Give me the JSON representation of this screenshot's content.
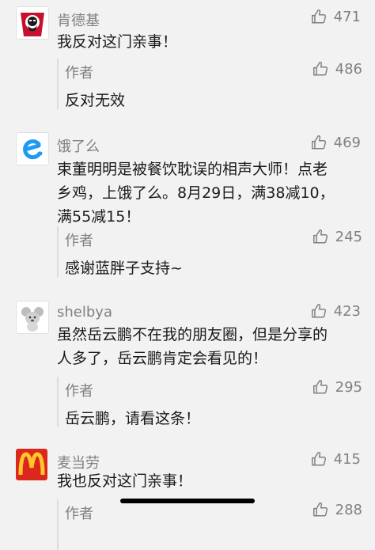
{
  "comments": [
    {
      "author": "肯德基",
      "avatar": "kfc-logo",
      "likes": "471",
      "text": [
        "我反对这门亲事！"
      ],
      "reply": {
        "author": "作者",
        "likes": "486",
        "text": "反对无效"
      }
    },
    {
      "author": "饿了么",
      "avatar": "eleme-logo",
      "likes": "469",
      "text": [
        "束董明明是被餐饮耽误的相声大师！点老",
        "乡鸡，上饿了么。8月29日，满38减10，",
        "满55减15！"
      ],
      "reply": {
        "author": "作者",
        "likes": "245",
        "text": "感谢蓝胖子支持~"
      }
    },
    {
      "author": "shelbya",
      "avatar": "koala-avatar",
      "likes": "423",
      "text": [
        "虽然岳云鹏不在我的朋友圈，但是分享的",
        "人多了，岳云鹏肯定会看见的！"
      ],
      "reply": {
        "author": "作者",
        "likes": "295",
        "text": "岳云鹏，请看这条！"
      }
    },
    {
      "author": "麦当劳",
      "avatar": "mcdonalds-logo",
      "likes": "415",
      "text": [
        "我也反对这门亲事！"
      ],
      "reply": {
        "author": "作者",
        "likes": "288",
        "text": ""
      }
    }
  ],
  "colors": {
    "background": "#f2f2f2",
    "meta_gray": "#808080",
    "text": "#1a1a1a",
    "mcdonalds_red": "#da291c",
    "mcdonalds_yellow": "#ffc72c",
    "eleme_blue": "#1e9bf0"
  }
}
